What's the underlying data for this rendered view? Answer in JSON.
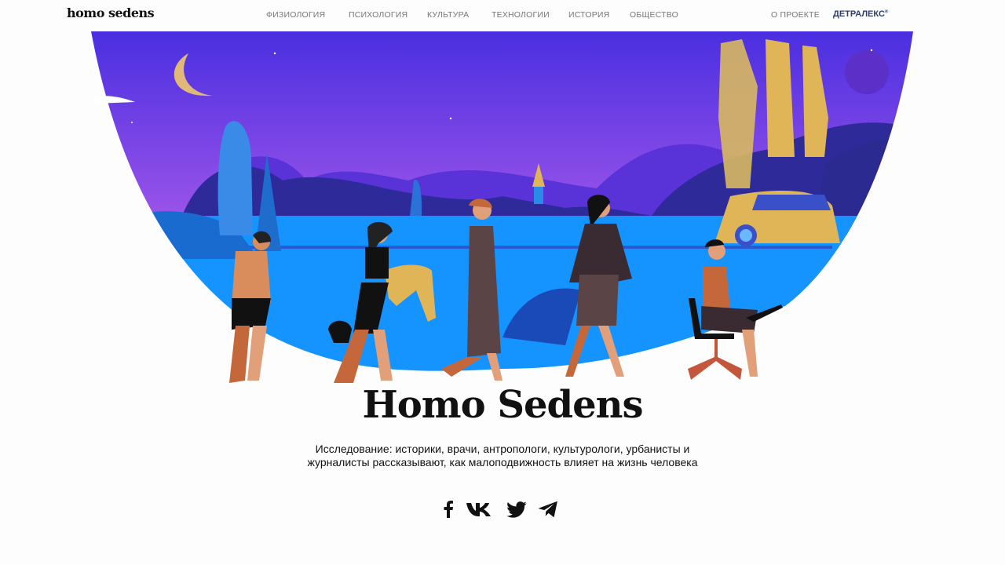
{
  "header": {
    "logo": "homo sedens",
    "nav": [
      "ФИЗИОЛОГИЯ",
      "ПСИХОЛОГИЯ",
      "КУЛЬТУРА",
      "ТЕХНОЛОГИИ",
      "ИСТОРИЯ",
      "ОБЩЕСТВО"
    ],
    "about": "О ПРОЕКТЕ",
    "partner": "ДЕТРАЛЕКС",
    "partner_mark": "®"
  },
  "hero": {
    "title": "Homo Sedens",
    "description": "Исследование: историки, врачи, антропологи, культурологи, урбанисты и журналисты рассказывают, как малоподвижность влияет на жизнь человека"
  },
  "social": [
    "facebook-icon",
    "vk-icon",
    "twitter-icon",
    "telegram-icon"
  ],
  "colors": {
    "sky_top": "#4a2fe0",
    "sky_bottom": "#9a55ea",
    "water": "#1594ff",
    "hills": "#2e2a9a",
    "partner": "#2f3d6c"
  }
}
